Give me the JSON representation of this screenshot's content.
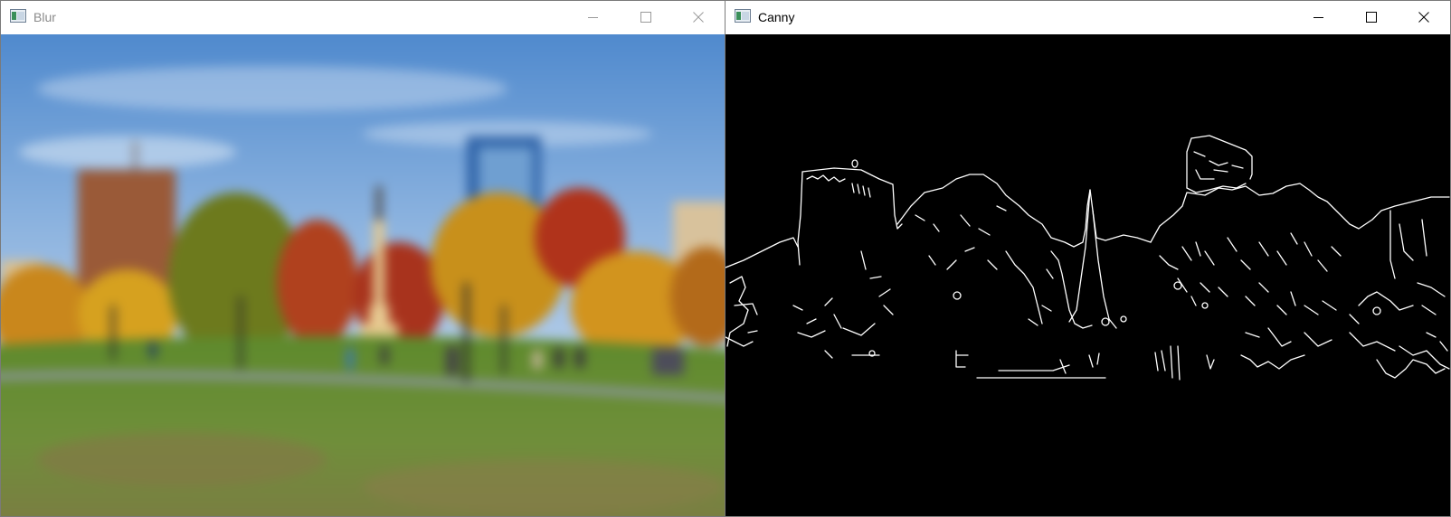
{
  "windows": {
    "blur": {
      "title": "Blur",
      "state": "inactive",
      "icons": {
        "app": "app-window-icon",
        "minimize": "minimize-icon",
        "maximize": "maximize-icon",
        "close": "close-icon"
      }
    },
    "canny": {
      "title": "Canny",
      "state": "active",
      "icons": {
        "app": "app-window-icon",
        "minimize": "minimize-icon",
        "maximize": "maximize-icon",
        "close": "close-icon"
      }
    }
  },
  "colors": {
    "sky_top": "#4a86cc",
    "sky_bottom": "#a9c7e6",
    "grass": "#6b8f2e",
    "canny_background": "#000000",
    "canny_edges": "#ffffff"
  }
}
